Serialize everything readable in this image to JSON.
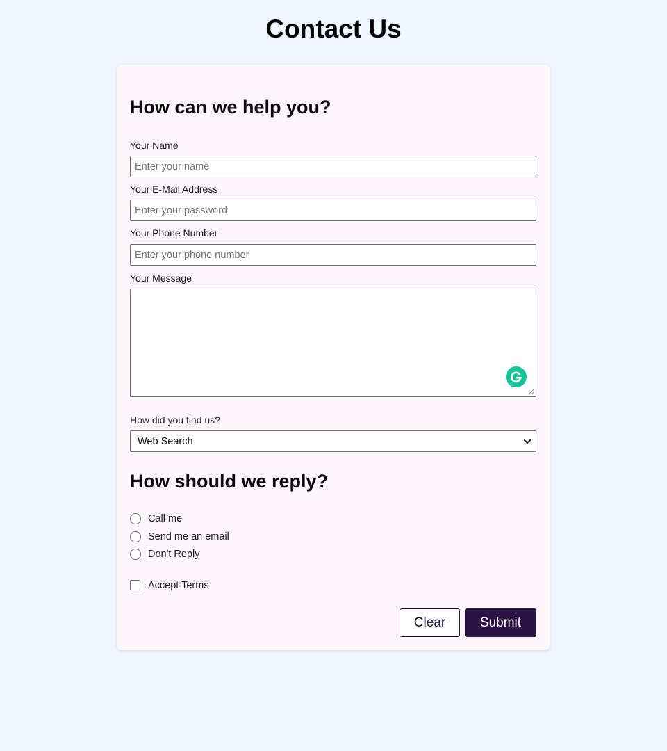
{
  "page": {
    "title": "Contact Us"
  },
  "form": {
    "section1_heading": "How can we help you?",
    "fields": {
      "name": {
        "label": "Your Name",
        "placeholder": "Enter your name",
        "value": ""
      },
      "email": {
        "label": "Your E-Mail Address",
        "placeholder": "Enter your password",
        "value": ""
      },
      "phone": {
        "label": "Your Phone Number",
        "placeholder": "Enter your phone number",
        "value": ""
      },
      "message": {
        "label": "Your Message",
        "value": ""
      }
    },
    "find_us": {
      "label": "How did you find us?",
      "selected": "Web Search"
    },
    "section2_heading": "How should we reply?",
    "reply_options": [
      {
        "label": "Call me",
        "checked": false
      },
      {
        "label": "Send me an email",
        "checked": false
      },
      {
        "label": "Don't Reply",
        "checked": false
      }
    ],
    "terms": {
      "label": "Accept Terms",
      "checked": false
    },
    "buttons": {
      "clear_label": "Clear",
      "submit_label": "Submit"
    }
  },
  "icons": {
    "grammarly": "grammarly-icon",
    "select_chevron": "chevron-down-icon",
    "resize_grip": "resize-grip-icon"
  },
  "colors": {
    "page_background": "#eff6ff",
    "card_background": "#fdf7fd",
    "primary": "#2a1245",
    "grammarly": "#15c39a"
  }
}
